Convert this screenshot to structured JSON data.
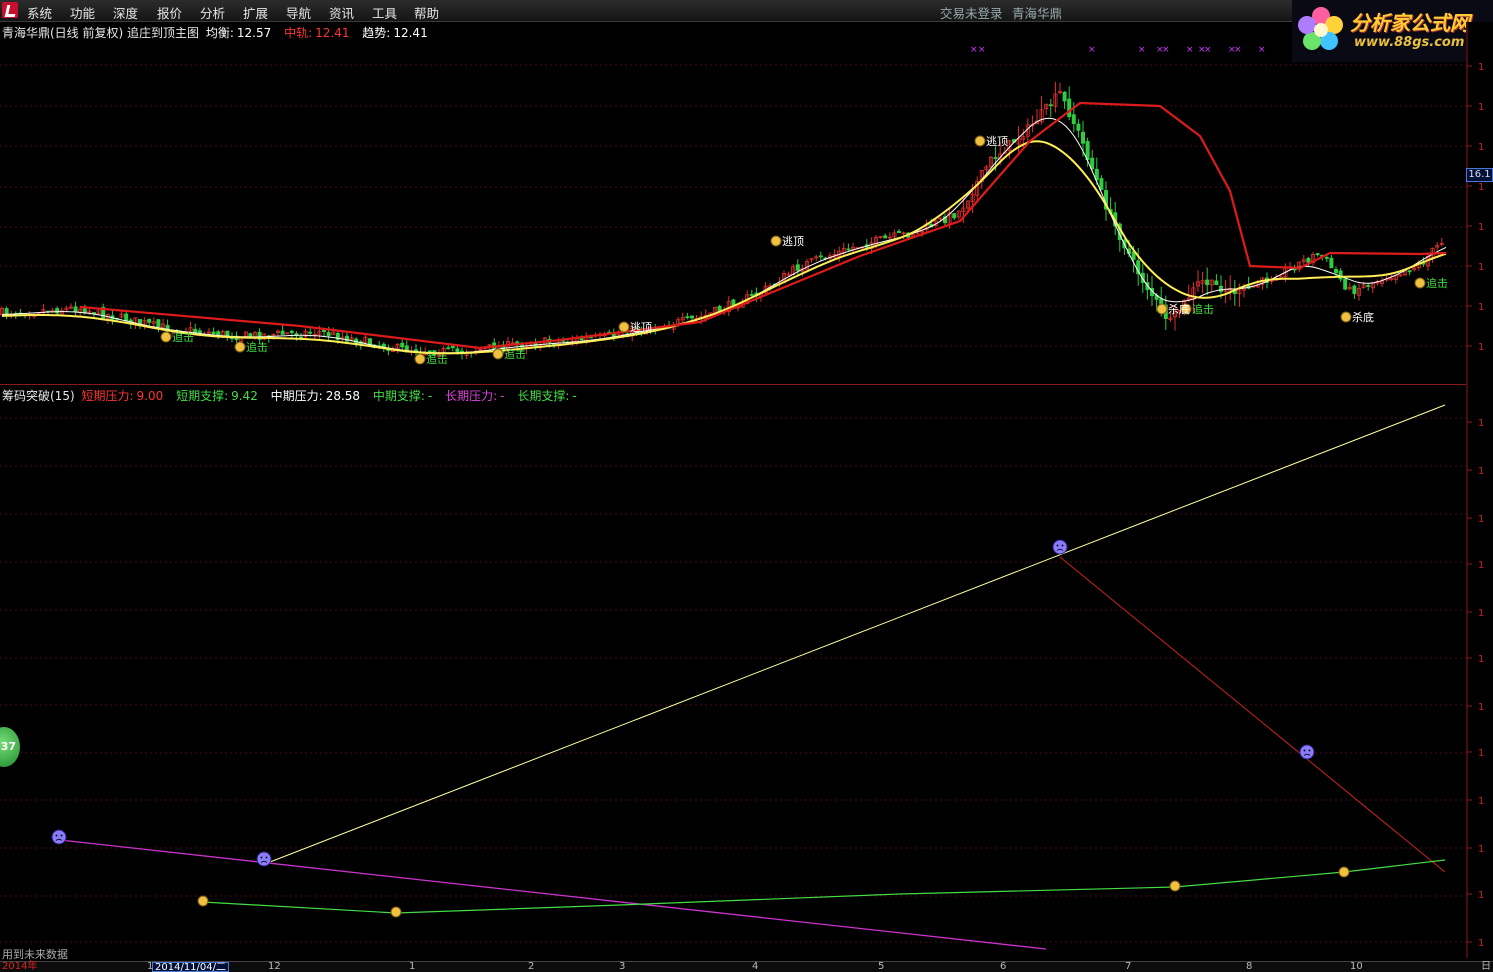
{
  "menu": [
    "系统",
    "功能",
    "深度",
    "报价",
    "分析",
    "扩展",
    "导航",
    "资讯",
    "工具",
    "帮助"
  ],
  "status": {
    "login": "交易未登录",
    "user": "青海华鼎"
  },
  "brand": {
    "title": "分析家公式网",
    "url": "www.88gs.com"
  },
  "main_legend": {
    "title": "青海华鼎(日线 前复权) 追庄到顶主图",
    "balance_label": "均衡:",
    "balance_value": "12.57",
    "mid_label": "中轨:",
    "mid_value": "12.41",
    "trend_label": "趋势:",
    "trend_value": "12.41"
  },
  "sub_legend": {
    "title": "筹码突破(15)",
    "short_pressure_label": "短期压力:",
    "short_pressure_value": "9.00",
    "short_support_label": "短期支撑:",
    "short_support_value": "9.42",
    "mid_pressure_label": "中期压力:",
    "mid_pressure_value": "28.58",
    "mid_support_label": "中期支撑:",
    "mid_support_value": "-",
    "long_pressure_label": "长期压力:",
    "long_pressure_value": "-",
    "long_support_label": "长期支撑:",
    "long_support_value": "-"
  },
  "price_tag": "16.1",
  "future_note": "用到未来数据",
  "period_badge": "37",
  "time_axis": {
    "year": "2014年",
    "cursor_date": "2014/11/04/二",
    "labels": [
      "1",
      "12",
      "1",
      "2",
      "3",
      "4",
      "5",
      "6",
      "7",
      "8",
      "10",
      "日"
    ]
  },
  "colors": {
    "up": "#e03030",
    "down": "#2ecc40",
    "balance": "#ffee55",
    "mid": "#dd1b1b",
    "trend": "#ffffff",
    "pressure": "#cc33cc",
    "support": "#44dd44",
    "mid_pressure": "#ffffa0",
    "mid_support_down": "#cc2222"
  },
  "chart_data": {
    "type": "candlestick",
    "overlay_labels": {
      "escape_top": "逃顶",
      "chase": "追击",
      "kill_bottom": "杀底"
    }
  }
}
